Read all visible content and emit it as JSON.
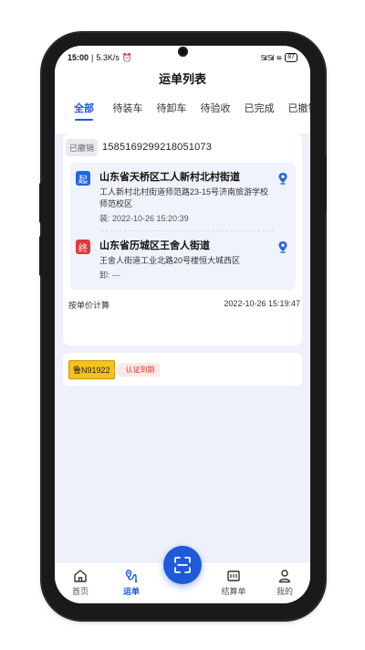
{
  "status_bar": {
    "time": "15:00",
    "network_speed": "5.3K/s",
    "signal": "Sıl Sıl",
    "battery": "87"
  },
  "header": {
    "title": "运单列表"
  },
  "tabs": [
    {
      "label": "全部",
      "active": true
    },
    {
      "label": "待装车",
      "active": false
    },
    {
      "label": "待卸车",
      "active": false
    },
    {
      "label": "待验收",
      "active": false
    },
    {
      "label": "已完成",
      "active": false
    },
    {
      "label": "已撤销",
      "active": false
    }
  ],
  "order": {
    "status_badge": "已撤销",
    "order_no": "1585169299218051073",
    "start": {
      "icon_label": "起",
      "title": "山东省天桥区工人新村北村街道",
      "address": "工人新村北村街道师范路23-15号济南旅游学校师范校区",
      "time": "装: 2022-10-26 15:20:39"
    },
    "end": {
      "icon_label": "终",
      "title": "山东省历城区王舍人街道",
      "address": "王舍人街道工业北路20号楼恒大城西区",
      "time": "卸: ---"
    },
    "pricing": "按单价计算",
    "datetime": "2022-10-26 15:19:47"
  },
  "vehicle": {
    "plate": "鲁N91922",
    "warning": "认证到期"
  },
  "bottom_nav": [
    {
      "label": "首页",
      "icon": "home-icon",
      "active": false
    },
    {
      "label": "运单",
      "icon": "waybill-icon",
      "active": true
    },
    {
      "label": "结算单",
      "icon": "settlement-icon",
      "active": false
    },
    {
      "label": "我的",
      "icon": "profile-icon",
      "active": false
    }
  ],
  "colors": {
    "accent": "#1e5bd8",
    "start": "#2266dd",
    "end": "#e03a3a",
    "plate": "#f6c21c",
    "warning": "#dd3333"
  }
}
